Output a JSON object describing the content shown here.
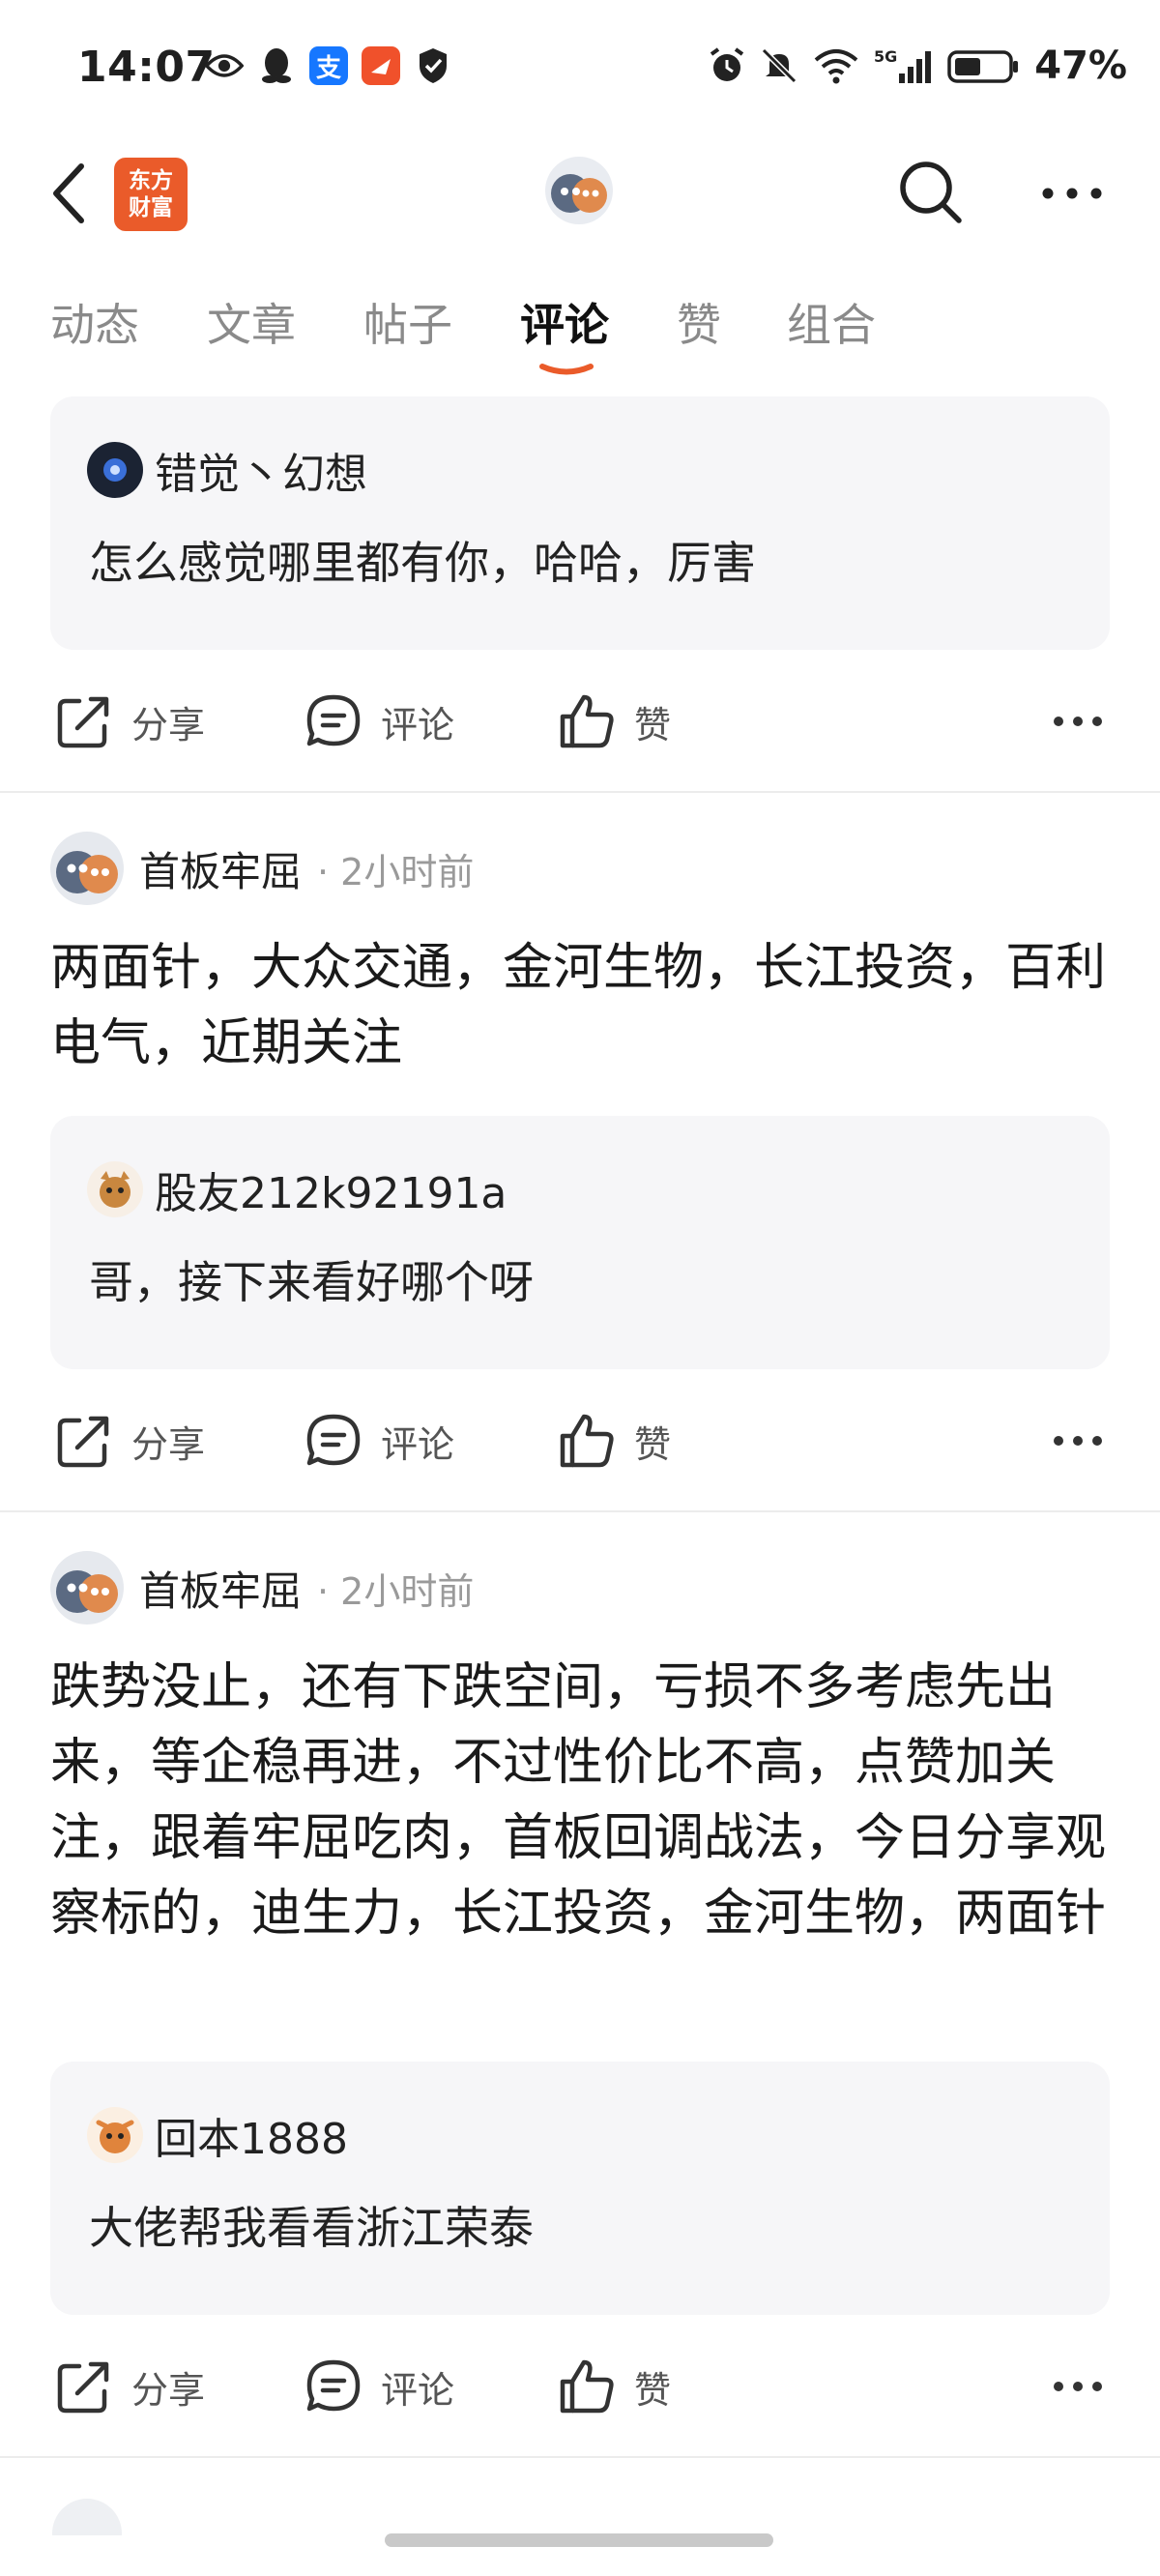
{
  "status_bar": {
    "time": "14:07",
    "battery": "47%",
    "network": "5G",
    "left_icons": [
      "eye-icon",
      "qq-icon",
      "alipay-icon",
      "app-icon",
      "shield-icon"
    ],
    "right_icons": [
      "alarm-icon",
      "mute-icon",
      "wifi-icon",
      "signal-icon",
      "battery-icon"
    ],
    "alipay_glyph": "支"
  },
  "header": {
    "app_logo_line1": "东方",
    "app_logo_line2": "财富",
    "accent_color": "#ea5b2a"
  },
  "tabs": [
    {
      "label": "动态",
      "active": false
    },
    {
      "label": "文章",
      "active": false
    },
    {
      "label": "帖子",
      "active": false
    },
    {
      "label": "评论",
      "active": true
    },
    {
      "label": "赞",
      "active": false
    },
    {
      "label": "组合",
      "active": false
    }
  ],
  "actions": {
    "share": "分享",
    "comment": "评论",
    "like": "赞"
  },
  "feed": [
    {
      "quote": {
        "user": "错觉丶幻想",
        "text": "怎么感觉哪里都有你，哈哈，厉害"
      }
    },
    {
      "author": "首板牢屈",
      "time": "· 2小时前",
      "body": "两面针，大众交通，金河生物，长江投资，百利电气，近期关注",
      "quote": {
        "user": "股友212k92191a",
        "text": "哥，接下来看好哪个呀"
      }
    },
    {
      "author": "首板牢屈",
      "time": "· 2小时前",
      "body": "跌势没止，还有下跌空间，亏损不多考虑先出来，等企稳再进，不过性价比不高，点赞加关注，跟着牢屈吃肉，首板回调战法，今日分享观察标的，迪生力，长江投资，金河生物，两面针",
      "quote": {
        "user": "回本1888",
        "text": "大佬帮我看看浙江荣泰"
      }
    }
  ]
}
